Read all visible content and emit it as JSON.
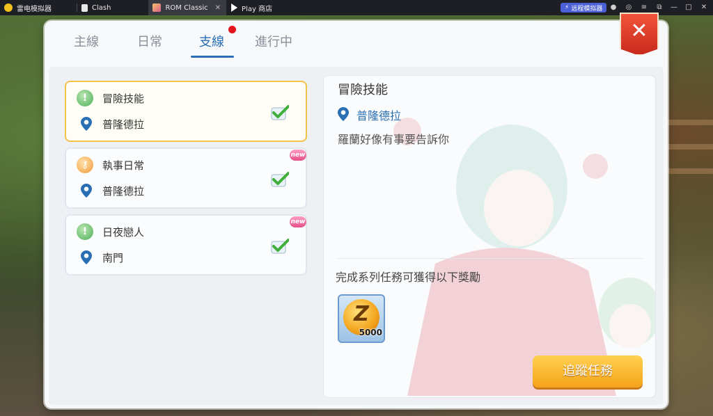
{
  "titlebar": {
    "tabs": [
      {
        "label": "雷电模拟器"
      },
      {
        "label": "Clash"
      },
      {
        "label": "ROM Classic",
        "close": "✕"
      },
      {
        "label": "Play 商店"
      }
    ],
    "remote_label": "远程模拟器"
  },
  "tabs": [
    {
      "label": "主線"
    },
    {
      "label": "日常"
    },
    {
      "label": "支線"
    },
    {
      "label": "進行中"
    }
  ],
  "active_tab": "支線",
  "quests": [
    {
      "title": "冒險技能",
      "location": "普隆德拉",
      "icon": "green-exclamation",
      "new": false,
      "selected": true
    },
    {
      "title": "執事日常",
      "location": "普隆德拉",
      "icon": "orange-quest",
      "new": true,
      "selected": false
    },
    {
      "title": "日夜戀人",
      "location": "南門",
      "icon": "green-exclamation",
      "new": true,
      "selected": false
    }
  ],
  "new_badge": "new",
  "detail": {
    "title": "冒險技能",
    "location": "普隆德拉",
    "description": "羅蘭好像有事要告訴你",
    "reward_label": "完成系列任務可獲得以下獎勵",
    "reward_amount": "5000",
    "track_button": "追蹤任務"
  },
  "colors": {
    "accent": "#2a6fb3",
    "selected_border": "#f2c24c",
    "button_orange": "#f6a21a",
    "close_red": "#d8361f"
  }
}
